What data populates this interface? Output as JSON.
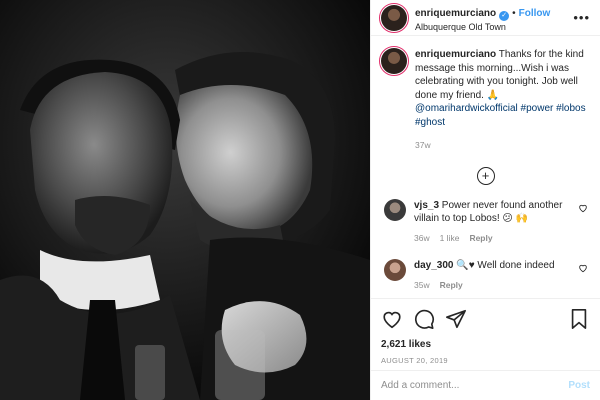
{
  "post": {
    "author": "enriquemurciano",
    "separator": "•",
    "follow_label": "Follow",
    "location": "Albuquerque Old Town",
    "more_label": "•••",
    "caption_text": " Thanks for the kind message this morning...Wish i was celebrating with you tonight. Job well done my friend. 🙏 ",
    "caption_mention": "@omarihardwickofficial",
    "caption_tags": " #power #lobos #ghost",
    "age": "37w",
    "load_more_label": "+",
    "likes": "2,621 likes",
    "date": "AUGUST 20, 2019"
  },
  "comments": [
    {
      "user": "vjs_3",
      "text": " Power never found another villain to top Lobos! 😕 🙌",
      "age": "36w",
      "likes": "1 like",
      "reply": "Reply"
    },
    {
      "user": "day_300",
      "text": " 🔍♥ Well done indeed",
      "age": "35w",
      "reply": "Reply"
    }
  ],
  "composer": {
    "placeholder": "Add a comment...",
    "post_label": "Post"
  },
  "icons": {
    "like": "heart-icon",
    "comment": "comment-icon",
    "share": "share-icon",
    "save": "bookmark-icon",
    "verified": "verified-badge-icon",
    "load_more": "plus-circle-icon"
  },
  "colors": {
    "link": "#00376b",
    "accent": "#3897f0",
    "muted": "#8e8e8e",
    "post_disabled": "#b2dffc"
  }
}
